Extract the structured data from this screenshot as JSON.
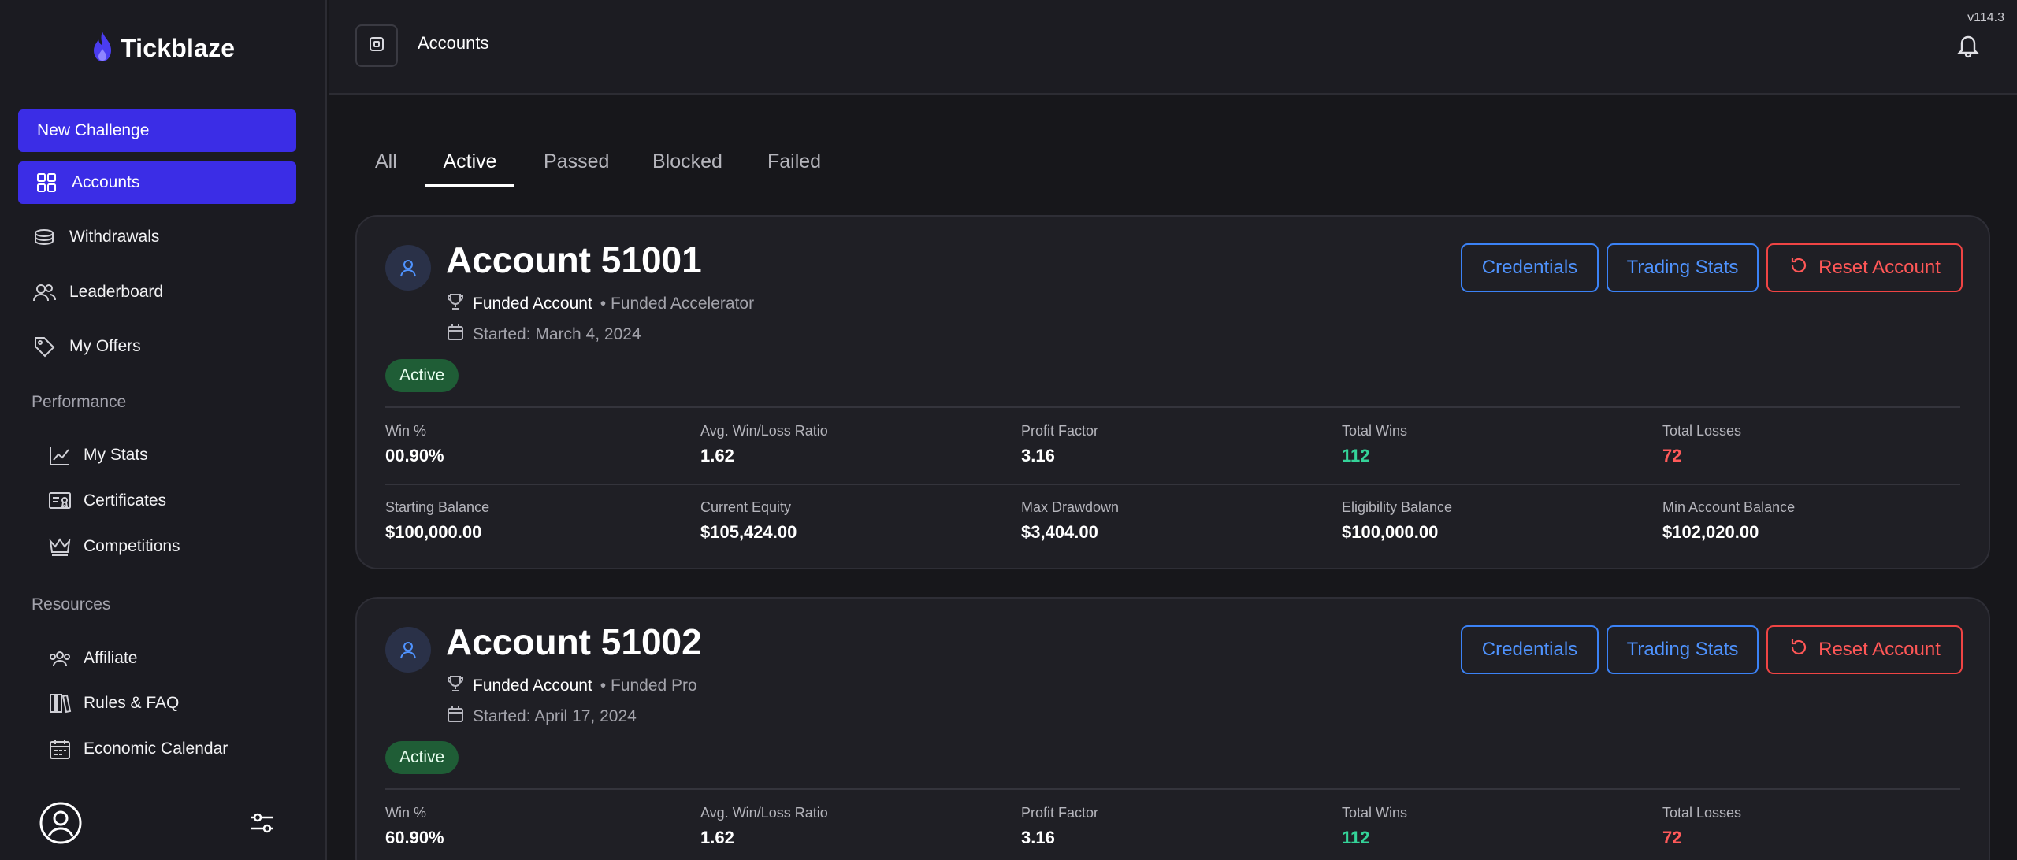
{
  "app": {
    "name": "Tickblaze",
    "version": "v114.3"
  },
  "sidebar": {
    "new_challenge": "New Challenge",
    "items": [
      {
        "label": "Accounts",
        "icon": "grid-icon"
      },
      {
        "label": "Withdrawals",
        "icon": "coins-icon"
      },
      {
        "label": "Leaderboard",
        "icon": "users-icon"
      },
      {
        "label": "My Offers",
        "icon": "tag-icon"
      }
    ],
    "performance_title": "Performance",
    "performance": [
      {
        "label": "My Stats",
        "icon": "chart-line-icon"
      },
      {
        "label": "Certificates",
        "icon": "certificate-icon"
      },
      {
        "label": "Competitions",
        "icon": "crown-icon"
      }
    ],
    "resources_title": "Resources",
    "resources": [
      {
        "label": "Affiliate",
        "icon": "users-icon"
      },
      {
        "label": "Rules & FAQ",
        "icon": "books-icon"
      },
      {
        "label": "Economic Calendar",
        "icon": "calendar-icon"
      }
    ]
  },
  "header": {
    "breadcrumb": "Accounts"
  },
  "tabs": [
    "All",
    "Active",
    "Passed",
    "Blocked",
    "Failed"
  ],
  "active_tab": "Active",
  "buttons": {
    "credentials": "Credentials",
    "trading_stats": "Trading Stats",
    "reset": "Reset Account"
  },
  "accounts": [
    {
      "title": "Account 51001",
      "type": "Funded Account",
      "program": "• Funded Accelerator",
      "started": "Started: March 4, 2024",
      "status": "Active",
      "stats_row1": [
        {
          "label": "Win %",
          "value": "00.90%"
        },
        {
          "label": "Avg. Win/Loss Ratio",
          "value": "1.62"
        },
        {
          "label": "Profit Factor",
          "value": "3.16"
        },
        {
          "label": "Total Wins",
          "value": "112"
        },
        {
          "label": "Total Losses",
          "value": "72"
        }
      ],
      "stats_row2": [
        {
          "label": "Starting Balance",
          "value": "$100,000.00"
        },
        {
          "label": "Current Equity",
          "value": "$105,424.00"
        },
        {
          "label": "Max Drawdown",
          "value": "$3,404.00"
        },
        {
          "label": "Eligibility Balance",
          "value": "$100,000.00"
        },
        {
          "label": "Min Account Balance",
          "value": "$102,020.00"
        }
      ]
    },
    {
      "title": "Account 51002",
      "type": "Funded Account",
      "program": "• Funded Pro",
      "started": "Started: April 17, 2024",
      "status": "Active",
      "stats_row1": [
        {
          "label": "Win %",
          "value": "60.90%"
        },
        {
          "label": "Avg. Win/Loss Ratio",
          "value": "1.62"
        },
        {
          "label": "Profit Factor",
          "value": "3.16"
        },
        {
          "label": "Total Wins",
          "value": "112"
        },
        {
          "label": "Total Losses",
          "value": "72"
        }
      ]
    }
  ],
  "colors": {
    "accent": "#3b2de6",
    "blue": "#4f93ff",
    "red": "#ff5757",
    "green": "#34d399",
    "badge_bg": "#1f5d36"
  }
}
